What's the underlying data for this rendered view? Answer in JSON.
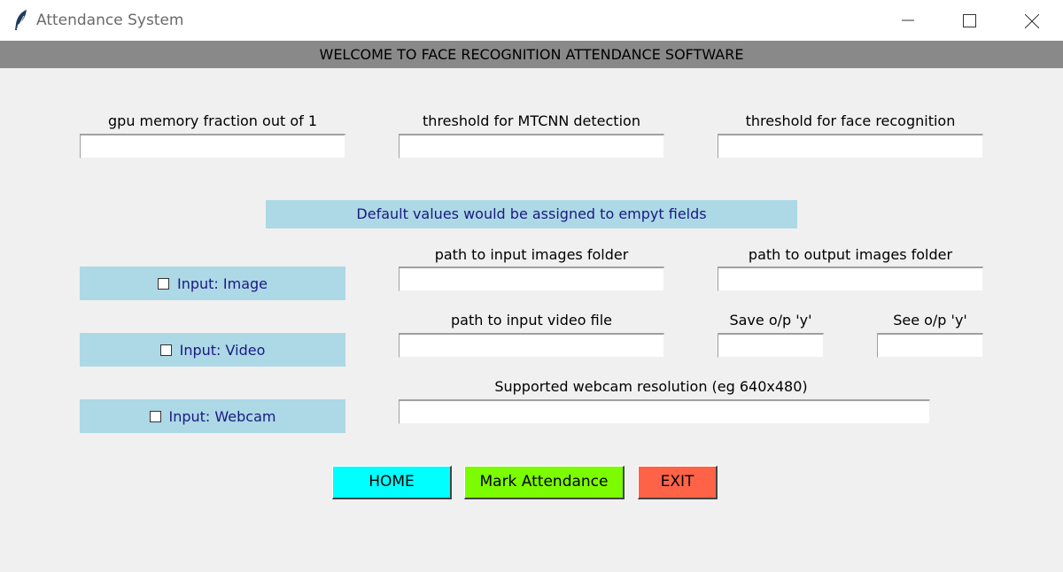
{
  "window": {
    "title": "Attendance System",
    "icon": "feather-icon",
    "controls": [
      "minimize-icon",
      "maximize-icon",
      "close-icon"
    ]
  },
  "banner": "WELCOME TO FACE  RECOGNITION ATTENDANCE SOFTWARE",
  "params": {
    "gpu_label": "gpu memory fraction out of 1",
    "gpu_value": "",
    "mtcnn_label": "threshold for MTCNN detection",
    "mtcnn_value": "",
    "face_label": "threshold for face recognition",
    "face_value": ""
  },
  "note": "Default values would be assigned to empyt fields",
  "inputs": {
    "image_label": "Input: Image",
    "image_checked": false,
    "video_label": "Input: Video",
    "video_checked": false,
    "webcam_label": "Input: Webcam",
    "webcam_checked": false
  },
  "paths": {
    "input_images_label": "path to input images folder",
    "input_images_value": "",
    "output_images_label": "path to output images folder",
    "output_images_value": "",
    "input_video_label": "path to input video file",
    "input_video_value": "",
    "save_label": "Save o/p 'y'",
    "save_value": "",
    "see_label": "See o/p 'y'",
    "see_value": "",
    "webcam_res_label": "Supported webcam resolution (eg 640x480)",
    "webcam_res_value": ""
  },
  "buttons": {
    "home": "HOME",
    "mark": "Mark Attendance",
    "exit": "EXIT"
  },
  "colors": {
    "banner_bg": "#898989",
    "panel_bg": "#add8e6",
    "home_bg": "#00ffff",
    "mark_bg": "#7cfc00",
    "exit_bg": "#ff6347"
  }
}
